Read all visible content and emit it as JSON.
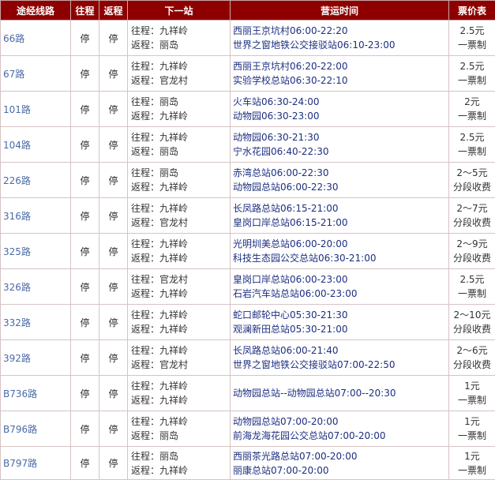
{
  "headers": [
    "途经线路",
    "往程",
    "返程",
    "下一站",
    "营运时间",
    "票价表"
  ],
  "rows": [
    {
      "route": "66路",
      "go": "停",
      "back": "停",
      "next1": "往程：九祥岭",
      "next2": "返程：丽岛",
      "hours1": "西丽王京坑村06:00-22:20",
      "hours2": "世界之窗地铁公交接驳站06:10-23:00",
      "fare1": "2.5元",
      "fare2": "一票制"
    },
    {
      "route": "67路",
      "go": "停",
      "back": "停",
      "next1": "往程：九祥岭",
      "next2": "返程：官龙村",
      "hours1": "西丽王京坑村06:20-22:00",
      "hours2": "实验学校总站06:30-22:10",
      "fare1": "2.5元",
      "fare2": "一票制"
    },
    {
      "route": "101路",
      "go": "停",
      "back": "停",
      "next1": "往程：丽岛",
      "next2": "返程：九祥岭",
      "hours1": "火车站06:30-24:00",
      "hours2": "动物园06:30-23:00",
      "fare1": "2元",
      "fare2": "一票制"
    },
    {
      "route": "104路",
      "go": "停",
      "back": "停",
      "next1": "往程：九祥岭",
      "next2": "返程：丽岛",
      "hours1": "动物园06:30-21:30",
      "hours2": "宁水花园06:40-22:30",
      "fare1": "2.5元",
      "fare2": "一票制"
    },
    {
      "route": "226路",
      "go": "停",
      "back": "停",
      "next1": "往程：丽岛",
      "next2": "返程：九祥岭",
      "hours1": "赤湾总站06:00-22:30",
      "hours2": "动物园总站06:00-22:30",
      "fare1": "2～5元",
      "fare2": "分段收费"
    },
    {
      "route": "316路",
      "go": "停",
      "back": "停",
      "next1": "往程：九祥岭",
      "next2": "返程：官龙村",
      "hours1": "长凤路总站06:15-21:00",
      "hours2": "皇岗口岸总站06:15-21:00",
      "fare1": "2～7元",
      "fare2": "分段收费"
    },
    {
      "route": "325路",
      "go": "停",
      "back": "停",
      "next1": "往程：九祥岭",
      "next2": "返程：九祥岭",
      "hours1": "光明圳美总站06:00-20:00",
      "hours2": "科技生态园公交总站06:30-21:00",
      "fare1": "2～9元",
      "fare2": "分段收费"
    },
    {
      "route": "326路",
      "go": "停",
      "back": "停",
      "next1": "往程：官龙村",
      "next2": "返程：九祥岭",
      "hours1": "皇岗口岸总站06:00-23:00",
      "hours2": "石岩汽车站总站06:00-23:00",
      "fare1": "2.5元",
      "fare2": "一票制"
    },
    {
      "route": "332路",
      "go": "停",
      "back": "停",
      "next1": "往程：九祥岭",
      "next2": "返程：九祥岭",
      "hours1": "蛇口邮轮中心05:30-21:30",
      "hours2": "观澜新田总站05:30-21:00",
      "fare1": "2～10元",
      "fare2": "分段收费"
    },
    {
      "route": "392路",
      "go": "停",
      "back": "停",
      "next1": "往程：九祥岭",
      "next2": "返程：官龙村",
      "hours1": "长凤路总站06:00-21:40",
      "hours2": "世界之窗地铁公交接驳站07:00-22:50",
      "fare1": "2～6元",
      "fare2": "分段收费"
    },
    {
      "route": "B736路",
      "go": "停",
      "back": "停",
      "next1": "往程：九祥岭",
      "next2": "返程：九祥岭",
      "hours1": "动物园总站--动物园总站07:00--20:30",
      "hours2": "",
      "fare1": "1元",
      "fare2": "一票制"
    },
    {
      "route": "B796路",
      "go": "停",
      "back": "停",
      "next1": "往程：九祥岭",
      "next2": "返程：丽岛",
      "hours1": "动物园总站07:00-20:00",
      "hours2": "前海龙海花园公交总站07:00-20:00",
      "fare1": "1元",
      "fare2": "一票制"
    },
    {
      "route": "B797路",
      "go": "停",
      "back": "停",
      "next1": "往程：丽岛",
      "next2": "返程：九祥岭",
      "hours1": "西丽茶光路总站07:00-20:00",
      "hours2": "丽康总站07:00-20:00",
      "fare1": "1元",
      "fare2": "一票制"
    }
  ]
}
